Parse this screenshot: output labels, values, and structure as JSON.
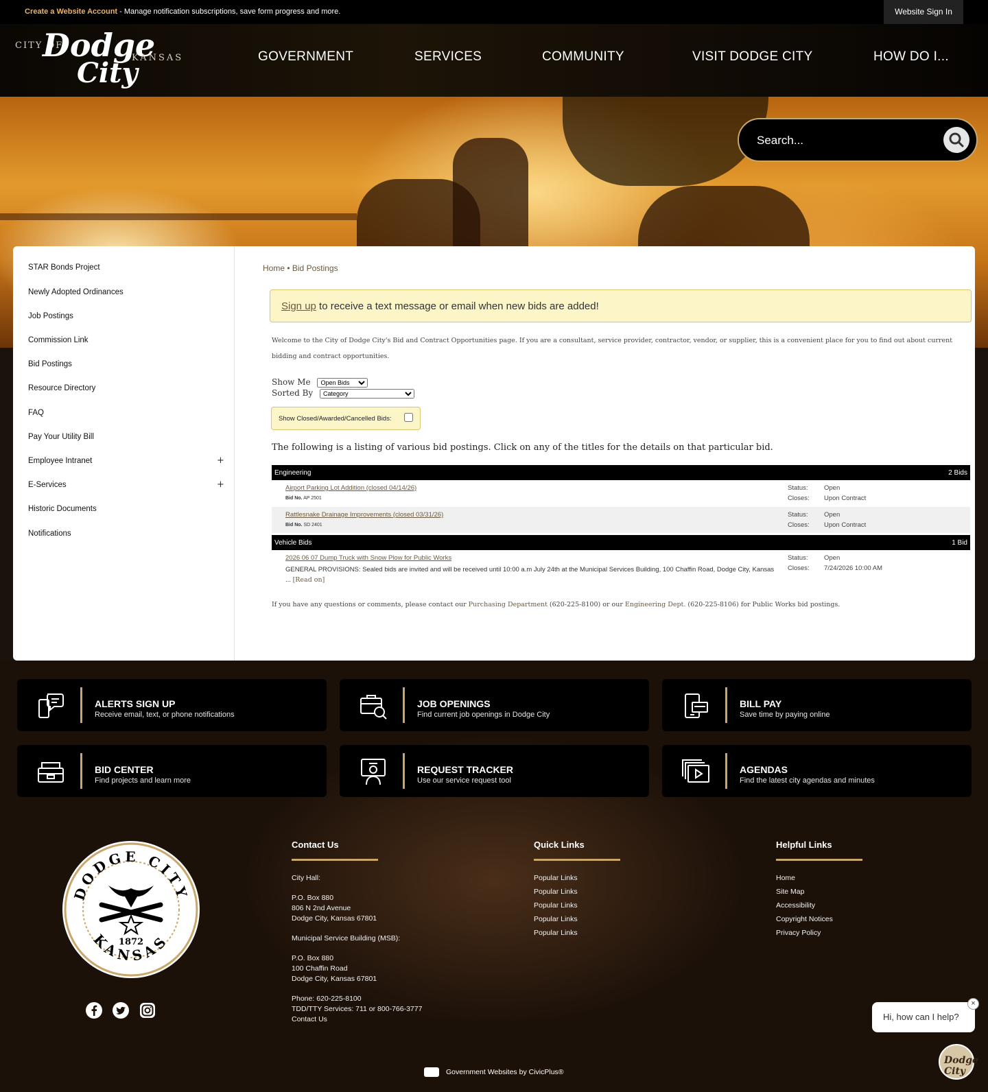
{
  "topbar": {
    "create_account": "Create a Website Account",
    "message": " - Manage notification subscriptions, save form progress and more.",
    "signin": "Website Sign In"
  },
  "logo": {
    "city_of": "CITY OF",
    "dodge": "Dodge",
    "city": "City",
    "kansas": "KANSAS"
  },
  "nav": [
    "GOVERNMENT",
    "SERVICES",
    "COMMUNITY",
    "VISIT DODGE CITY",
    "HOW DO I..."
  ],
  "search": {
    "placeholder": "Search..."
  },
  "sidebar": {
    "items": [
      "STAR Bonds Project",
      "Newly Adopted Ordinances",
      "Job Postings",
      "Commission Link",
      "Bid Postings",
      "Resource Directory",
      "FAQ",
      "Pay Your Utility Bill",
      "Employee Intranet",
      "E-Services",
      "Historic Documents",
      "Notifications"
    ],
    "expand_symbol": "+"
  },
  "breadcrumb": {
    "home": "Home",
    "sep": " • ",
    "current": "Bid Postings"
  },
  "alert": {
    "link": "Sign up",
    "text": " to receive a text message or email when new bids are added!"
  },
  "intro": "Welcome to the City of Dodge City's Bid and Contract Opportunities page. If you are a consultant, service provider, contractor, vendor, or supplier, this is a convenient place for you to find out about current bidding and contract opportunities.",
  "filters": {
    "show_me_label": "Show Me",
    "show_me_value": "Open Bids",
    "sorted_by_label": "Sorted By",
    "sorted_by_value": "Category",
    "closed_label": "Show Closed/Awarded/Cancelled Bids:"
  },
  "listing_intro": "The following is a listing of various bid postings. Click on any of the titles for the details on that particular bid.",
  "categories": [
    {
      "name": "Engineering",
      "count": "2 Bids",
      "bids": [
        {
          "title": "Airport Parking Lot Addition (closed 04/14/26)",
          "bidno_label": "Bid No.",
          "bidno": "AP 2501",
          "status_label": "Status:",
          "status": "Open",
          "closes_label": "Closes:",
          "closes": "Upon Contract"
        },
        {
          "title": "Rattlesnake Drainage Improvements (closed 03/31/26)",
          "bidno_label": "Bid No.",
          "bidno": "SD 2401",
          "status_label": "Status:",
          "status": "Open",
          "closes_label": "Closes:",
          "closes": "Upon Contract"
        }
      ]
    },
    {
      "name": "Vehicle Bids",
      "count": "1 Bid",
      "bids": [
        {
          "title": "2026 06 07 Dump Truck with Snow Plow for Public Works",
          "desc": "GENERAL PROVISIONS: Sealed bids are invited and will be received until 10:00 a.m July 24th at the Municipal Services Building, 100 Chaffin Road, Dodge City, Kansas ... ",
          "read_on": "[Read on]",
          "status_label": "Status:",
          "status": "Open",
          "closes_label": "Closes:",
          "closes": "7/24/2026 10:00 AM"
        }
      ]
    }
  ],
  "contact_line": {
    "pre": "If you have any questions or comments, please contact our ",
    "purchasing": "Purchasing Department",
    "mid": " (620-225-8100) or our ",
    "engineering": "Engineering Dept.",
    "post": " (620-225-8106) for Public Works bid postings."
  },
  "tiles": [
    {
      "title": "ALERTS SIGN UP",
      "sub": "Receive email, text, or phone notifications",
      "icon": "chat-phone-icon"
    },
    {
      "title": "JOB OPENINGS",
      "sub": "Find current job openings in Dodge City",
      "icon": "briefcase-search-icon"
    },
    {
      "title": "BILL PAY",
      "sub": "Save time by paying online",
      "icon": "phone-bill-icon"
    },
    {
      "title": "BID CENTER",
      "sub": "Find projects and learn more",
      "icon": "inbox-tray-icon"
    },
    {
      "title": "REQUEST TRACKER",
      "sub": "Use our service request tool",
      "icon": "person-screen-icon"
    },
    {
      "title": "AGENDAS",
      "sub": "Find the latest city agendas and minutes",
      "icon": "video-stack-icon"
    }
  ],
  "seal": {
    "top": "DODGE CITY",
    "bottom": "KANSAS",
    "year": "1872"
  },
  "footer": {
    "contact": {
      "heading": "Contact Us",
      "lines": [
        "City Hall:",
        "P.O. Box 880",
        "806 N 2nd Avenue",
        "Dodge City, Kansas 67801",
        "Municipal Service Building (MSB):",
        "P.O. Box 880",
        "100 Chaffin Road",
        "Dodge City, Kansas 67801",
        "Phone: 620-225-8100",
        "TDD/TTY Services: 711 or 800-766-3777",
        "Contact Us"
      ]
    },
    "quick": {
      "heading": "Quick Links",
      "items": [
        "Popular Links",
        "Popular Links",
        "Popular Links",
        "Popular Links",
        "Popular Links"
      ]
    },
    "helpful": {
      "heading": "Helpful Links",
      "items": [
        "Home",
        "Site Map",
        "Accessibility",
        "Copyright Notices",
        "Privacy Policy"
      ]
    }
  },
  "civicplus": "Government Websites by CivicPlus®",
  "chat": {
    "text": "Hi, how can I help?",
    "close": "×",
    "avatar": "Dodge City"
  },
  "colors": {
    "accent": "#c9a66b",
    "link": "#6a5a3d",
    "alert_bg": "#fbf5c8"
  }
}
